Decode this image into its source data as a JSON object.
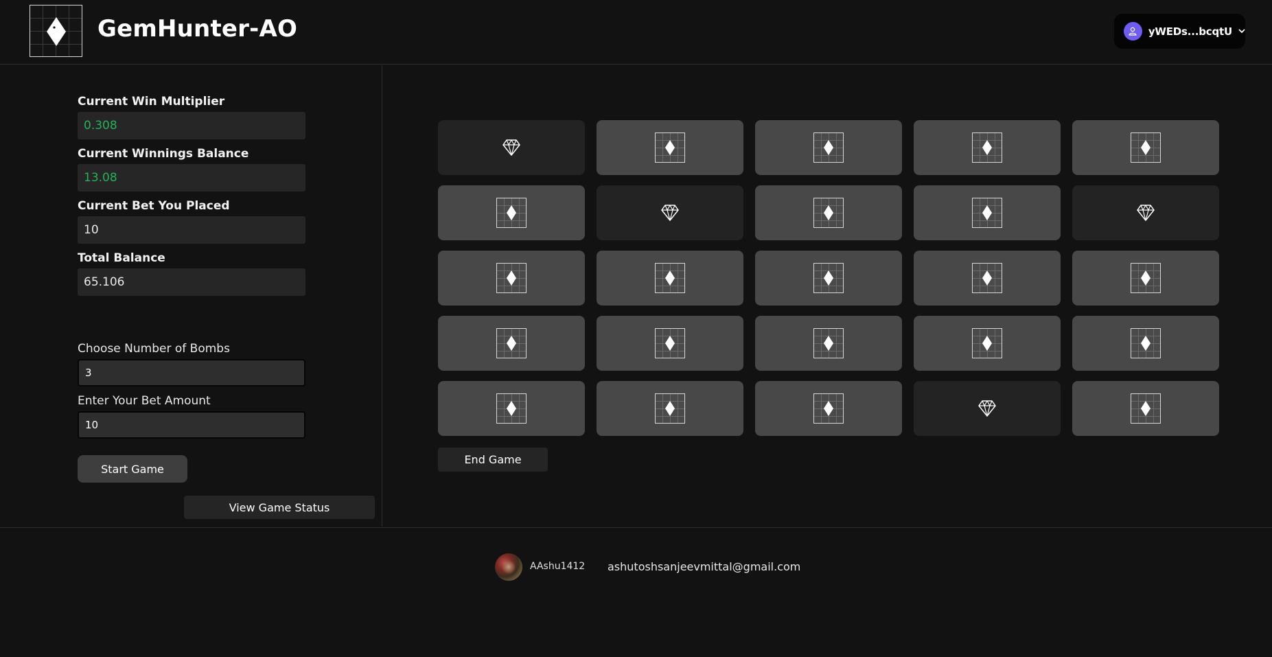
{
  "header": {
    "title": "GemHunter-AO",
    "logo_icon": "diamond-suit-icon",
    "wallet": {
      "address": "yWEDs...bcqtU",
      "avatar_icon": "user-icon",
      "chevron_icon": "chevron-down-icon",
      "avatar_color": "#6f5cf5"
    }
  },
  "stats": {
    "win_multiplier": {
      "label": "Current Win Multiplier",
      "value": "0.308"
    },
    "winnings_balance": {
      "label": "Current Winnings Balance",
      "value": "13.08"
    },
    "bet_placed": {
      "label": "Current Bet You Placed",
      "value": "10"
    },
    "total_balance": {
      "label": "Total Balance",
      "value": "65.106"
    }
  },
  "form": {
    "bombs": {
      "label": "Choose Number of Bombs",
      "value": "3"
    },
    "bet_amount": {
      "label": "Enter Your Bet Amount",
      "value": "10"
    },
    "start_label": "Start Game",
    "status_label": "View Game Status"
  },
  "game": {
    "end_label": "End Game",
    "tiles": [
      "gem",
      "hidden",
      "hidden",
      "hidden",
      "hidden",
      "hidden",
      "gem",
      "hidden",
      "hidden",
      "gem",
      "hidden",
      "hidden",
      "hidden",
      "hidden",
      "hidden",
      "hidden",
      "hidden",
      "hidden",
      "hidden",
      "hidden",
      "hidden",
      "hidden",
      "hidden",
      "gem",
      "hidden"
    ],
    "colors": {
      "hidden_tile": "#484848",
      "revealed_tile": "#232323",
      "accent_green": "#23b35a"
    }
  },
  "footer": {
    "username": "AAshu1412",
    "email": "ashutoshsanjeevmittal@gmail.com"
  }
}
